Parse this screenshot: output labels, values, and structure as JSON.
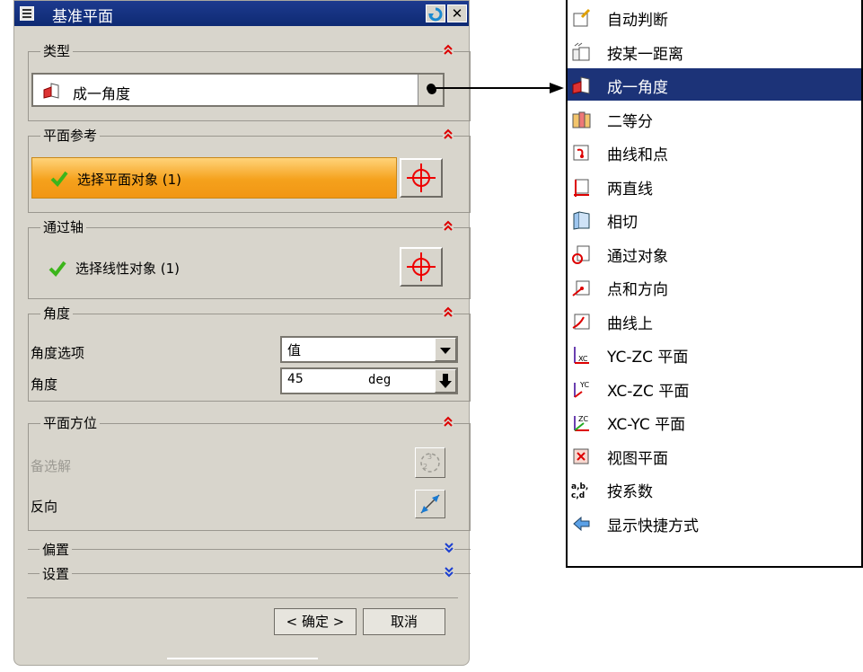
{
  "dialog": {
    "title": "基准平面",
    "type_group": {
      "title": "类型",
      "selected": "成一角度"
    },
    "plane_ref_group": {
      "title": "平面参考",
      "select_label": "选择平面对象 (1)"
    },
    "axis_group": {
      "title": "通过轴",
      "select_label": "选择线性对象 (1)"
    },
    "angle_group": {
      "title": "角度",
      "option_label": "角度选项",
      "option_value": "值",
      "angle_label": "角度",
      "angle_value": "45",
      "angle_unit": "deg"
    },
    "orient_group": {
      "title": "平面方位",
      "alt_solution": "备选解",
      "reverse": "反向"
    },
    "offset_group": {
      "title": "偏置"
    },
    "settings_group": {
      "title": "设置"
    },
    "ok_label": "< 确定 >",
    "cancel_label": "取消"
  },
  "menu": {
    "items": [
      {
        "label": "自动判断",
        "icon": "auto-infer-icon"
      },
      {
        "label": "按某一距离",
        "icon": "at-distance-icon"
      },
      {
        "label": "成一角度",
        "icon": "at-angle-icon",
        "selected": true
      },
      {
        "label": "二等分",
        "icon": "bisector-icon"
      },
      {
        "label": "曲线和点",
        "icon": "curve-point-icon"
      },
      {
        "label": "两直线",
        "icon": "two-lines-icon"
      },
      {
        "label": "相切",
        "icon": "tangent-icon"
      },
      {
        "label": "通过对象",
        "icon": "through-object-icon"
      },
      {
        "label": "点和方向",
        "icon": "point-direction-icon"
      },
      {
        "label": "曲线上",
        "icon": "on-curve-icon"
      },
      {
        "label": "YC-ZC 平面",
        "icon": "yc-zc-plane-icon"
      },
      {
        "label": "XC-ZC 平面",
        "icon": "xc-zc-plane-icon"
      },
      {
        "label": "XC-YC 平面",
        "icon": "xc-yc-plane-icon"
      },
      {
        "label": "视图平面",
        "icon": "view-plane-icon"
      },
      {
        "label": "按系数",
        "icon": "coefficients-icon"
      },
      {
        "label": "显示快捷方式",
        "icon": "show-shortcuts-icon"
      }
    ]
  },
  "colors": {
    "title_bar": "#0e2a73",
    "selection": "#1c3378",
    "highlight": "#f5a11c",
    "check": "#3cb51b"
  }
}
